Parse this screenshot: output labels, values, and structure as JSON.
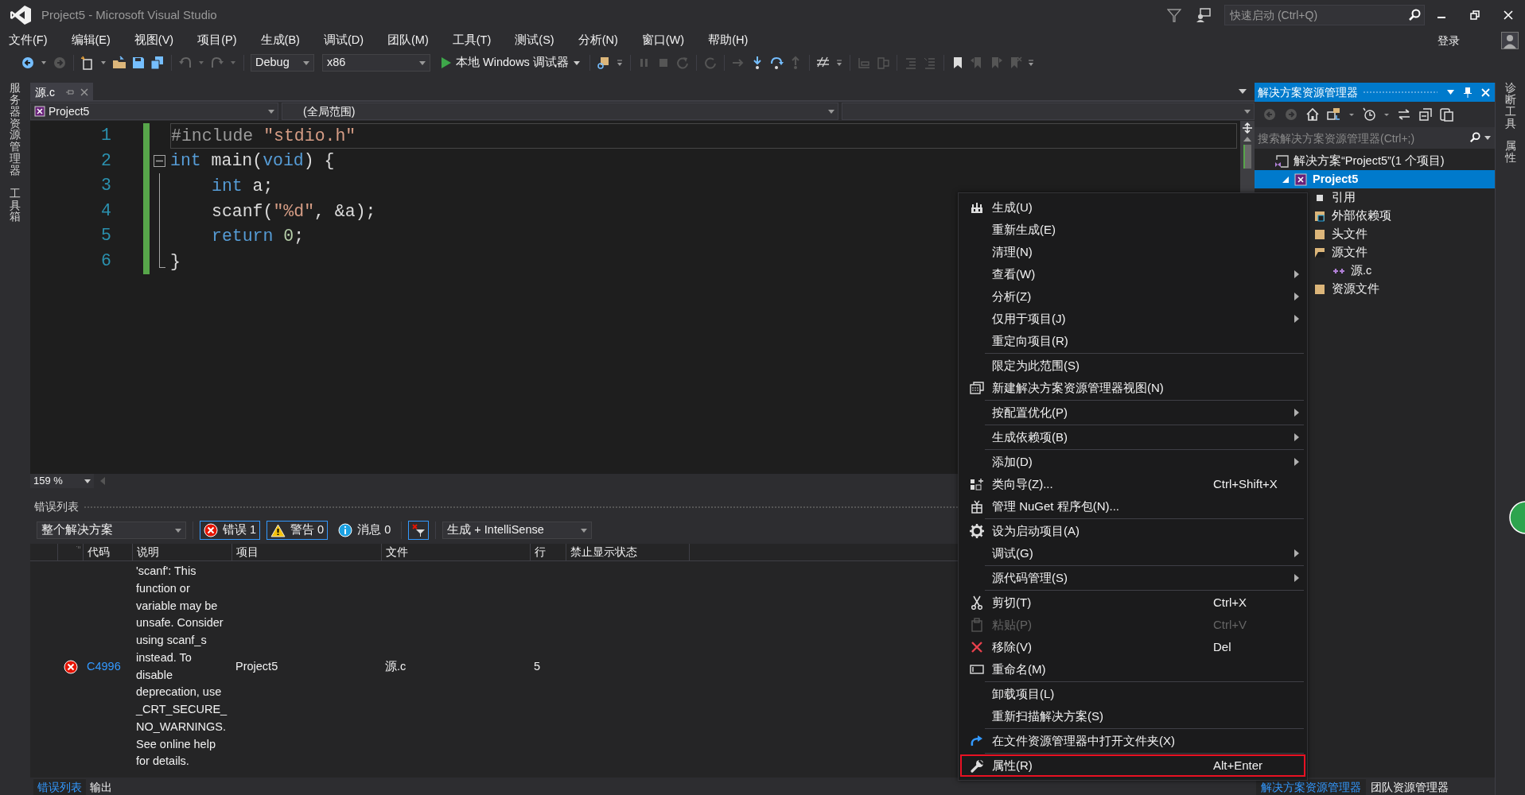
{
  "window": {
    "title": "Project5 - Microsoft Visual Studio"
  },
  "quick_launch": {
    "placeholder": "快速启动 (Ctrl+Q)"
  },
  "menu": [
    "文件(F)",
    "编辑(E)",
    "视图(V)",
    "项目(P)",
    "生成(B)",
    "调试(D)",
    "团队(M)",
    "工具(T)",
    "测试(S)",
    "分析(N)",
    "窗口(W)",
    "帮助(H)"
  ],
  "sign_in": "登录",
  "toolbar": {
    "configuration": "Debug",
    "platform": "x86",
    "debugger": "本地 Windows 调试器"
  },
  "left_rail": [
    "服务器资源管理器",
    "工具箱"
  ],
  "right_rail": [
    "诊断工具",
    "属性"
  ],
  "editor": {
    "tabs": [
      {
        "label": "源.c",
        "selected": true
      }
    ],
    "project_dropdown": "Project5",
    "scope_dropdown": "(全局范围)",
    "lines": [
      {
        "number": "1",
        "kind": "plain",
        "current": true,
        "indented": false,
        "tokens": [
          {
            "kind": "preprocessor",
            "text": "#include "
          },
          {
            "kind": "string",
            "text": "″stdio.h″"
          }
        ]
      },
      {
        "number": "2",
        "kind": "fold-start",
        "current": false,
        "indented": false,
        "tokens": [
          {
            "kind": "keyword",
            "text": "int"
          },
          {
            "kind": "text",
            "text": " main("
          },
          {
            "kind": "keyword",
            "text": "void"
          },
          {
            "kind": "text",
            "text": ") {"
          }
        ]
      },
      {
        "number": "3",
        "kind": "fold-body",
        "current": false,
        "indented": true,
        "tokens": [
          {
            "kind": "keyword",
            "text": "int"
          },
          {
            "kind": "text",
            "text": " a;"
          }
        ]
      },
      {
        "number": "4",
        "kind": "fold-body",
        "current": false,
        "indented": true,
        "tokens": [
          {
            "kind": "text",
            "text": "scanf("
          },
          {
            "kind": "string",
            "text": "″%d″"
          },
          {
            "kind": "text",
            "text": ", &a);"
          }
        ]
      },
      {
        "number": "5",
        "kind": "fold-body",
        "current": false,
        "indented": true,
        "tokens": [
          {
            "kind": "keyword",
            "text": "return "
          },
          {
            "kind": "number",
            "text": "0"
          },
          {
            "kind": "text",
            "text": ";"
          }
        ]
      },
      {
        "number": "6",
        "kind": "fold-end",
        "current": false,
        "indented": false,
        "tokens": [
          {
            "kind": "text",
            "text": "}"
          }
        ]
      }
    ],
    "zoom": "159 %"
  },
  "error_list": {
    "title": "错误列表",
    "scope": "整个解决方案",
    "filters": [
      {
        "kind": "error",
        "label": "错误 1",
        "selected": true
      },
      {
        "kind": "warning",
        "label": "警告 0",
        "selected": true
      },
      {
        "kind": "info",
        "label": "消息 0",
        "selected": false
      }
    ],
    "source": "生成 + IntelliSense",
    "columns": [
      "代码",
      "说明",
      "项目",
      "文件",
      "行",
      "禁止显示状态"
    ],
    "rows": [
      {
        "kind": "error",
        "code": "C4996",
        "description": "'scanf': This function or variable may be unsafe. Consider using scanf_s instead. To disable deprecation, use _CRT_SECURE_NO_WARNINGS. See online help for details.",
        "project": "Project5",
        "file": "源.c",
        "line": "5"
      }
    ]
  },
  "bottom_tabs": [
    {
      "label": "错误列表",
      "selected": true
    },
    {
      "label": "输出",
      "selected": false
    }
  ],
  "solution_explorer": {
    "title": "解决方案资源管理器",
    "search": {
      "placeholder": "搜索解决方案资源管理器(Ctrl+;)"
    },
    "tree": [
      {
        "label": "解决方案“Project5”(1 个项目)",
        "kind": "solution",
        "selected": false,
        "children": [
          {
            "label": "Project5",
            "kind": "project",
            "selected": true,
            "expanded": true,
            "children": [
              {
                "label": "引用",
                "kind": "references",
                "selected": false
              },
              {
                "label": "外部依赖项",
                "kind": "dependencies",
                "selected": false
              },
              {
                "label": "头文件",
                "kind": "folder",
                "selected": false
              },
              {
                "label": "源文件",
                "kind": "open-folder",
                "selected": false,
                "children": [
                  {
                    "label": "源.c",
                    "kind": "source-file",
                    "selected": false
                  }
                ]
              },
              {
                "label": "资源文件",
                "kind": "folder",
                "selected": false
              }
            ]
          }
        ]
      }
    ]
  },
  "side_tabs": [
    {
      "label": "解决方案资源管理器",
      "selected": true
    },
    {
      "label": "团队资源管理器",
      "selected": false
    }
  ],
  "context_menu": {
    "items": [
      {
        "label": "生成(U)"
      },
      {
        "label": "重新生成(E)"
      },
      {
        "label": "清理(N)"
      },
      {
        "label": "查看(W)",
        "submenu": true
      },
      {
        "label": "分析(Z)",
        "submenu": true
      },
      {
        "label": "仅用于项目(J)",
        "submenu": true
      },
      {
        "label": "重定向项目(R)"
      },
      {
        "label": "限定为此范围(S)",
        "separator_before": true
      },
      {
        "label": "新建解决方案资源管理器视图(N)"
      },
      {
        "label": "按配置优化(P)",
        "separator_before": true,
        "submenu": true
      },
      {
        "label": "生成依赖项(B)",
        "separator_before": true,
        "submenu": true
      },
      {
        "label": "添加(D)",
        "separator_before": true,
        "submenu": true
      },
      {
        "label": "类向导(Z)...",
        "shortcut": "Ctrl+Shift+X"
      },
      {
        "label": "管理 NuGet 程序包(N)..."
      },
      {
        "label": "设为启动项目(A)",
        "separator_before": true
      },
      {
        "label": "调试(G)",
        "submenu": true
      },
      {
        "label": "源代码管理(S)",
        "separator_before": true,
        "submenu": true
      },
      {
        "label": "剪切(T)",
        "separator_before": true,
        "shortcut": "Ctrl+X"
      },
      {
        "label": "粘贴(P)",
        "shortcut": "Ctrl+V",
        "disabled": true
      },
      {
        "label": "移除(V)",
        "shortcut": "Del"
      },
      {
        "label": "重命名(M)"
      },
      {
        "label": "卸载项目(L)",
        "separator_before": true
      },
      {
        "label": "重新扫描解决方案(S)"
      },
      {
        "label": "在文件资源管理器中打开文件夹(X)",
        "separator_before": true
      },
      {
        "label": "属性(R)",
        "separator_before": true,
        "shortcut": "Alt+Enter",
        "outlined": true
      }
    ]
  }
}
